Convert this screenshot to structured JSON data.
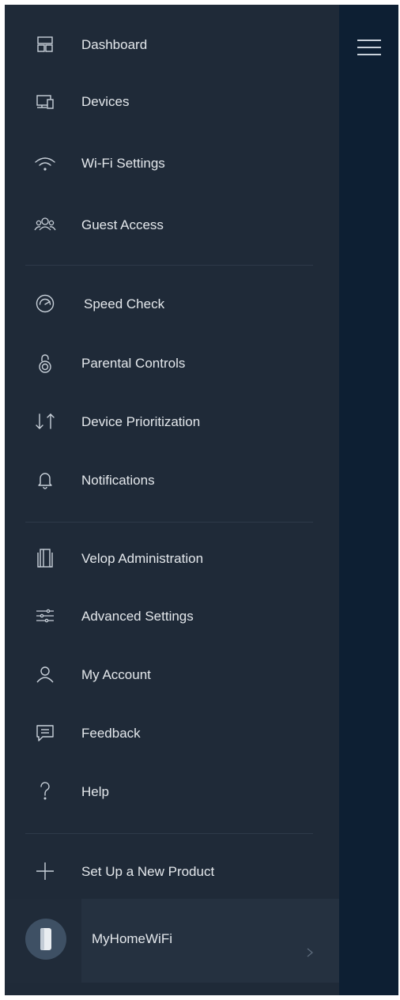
{
  "menu": {
    "primary": [
      {
        "label": "Dashboard",
        "icon": "dashboard-icon"
      },
      {
        "label": "Devices",
        "icon": "devices-icon"
      },
      {
        "label": "Wi-Fi Settings",
        "icon": "wifi-icon"
      },
      {
        "label": "Guest Access",
        "icon": "guest-access-icon"
      }
    ],
    "tools": [
      {
        "label": "Speed Check",
        "icon": "speedometer-icon"
      },
      {
        "label": "Parental Controls",
        "icon": "lock-icon"
      },
      {
        "label": "Device Prioritization",
        "icon": "priority-arrows-icon"
      },
      {
        "label": "Notifications",
        "icon": "bell-icon"
      }
    ],
    "settings": [
      {
        "label": "Velop Administration",
        "icon": "velop-node-icon"
      },
      {
        "label": "Advanced Settings",
        "icon": "sliders-icon"
      },
      {
        "label": "My Account",
        "icon": "user-icon"
      },
      {
        "label": "Feedback",
        "icon": "chat-bubble-icon"
      },
      {
        "label": "Help",
        "icon": "question-icon"
      }
    ],
    "setup": {
      "label": "Set Up a New Product",
      "icon": "plus-icon"
    }
  },
  "network": {
    "name": "MyHomeWiFi",
    "icon": "velop-node-icon"
  },
  "colors": {
    "drawer_bg": "#1f2a38",
    "right_pane_bg": "#0d1f33",
    "text": "#e4e8ec",
    "icon_stroke": "#c9d1da",
    "divider": "#2e3a49"
  }
}
